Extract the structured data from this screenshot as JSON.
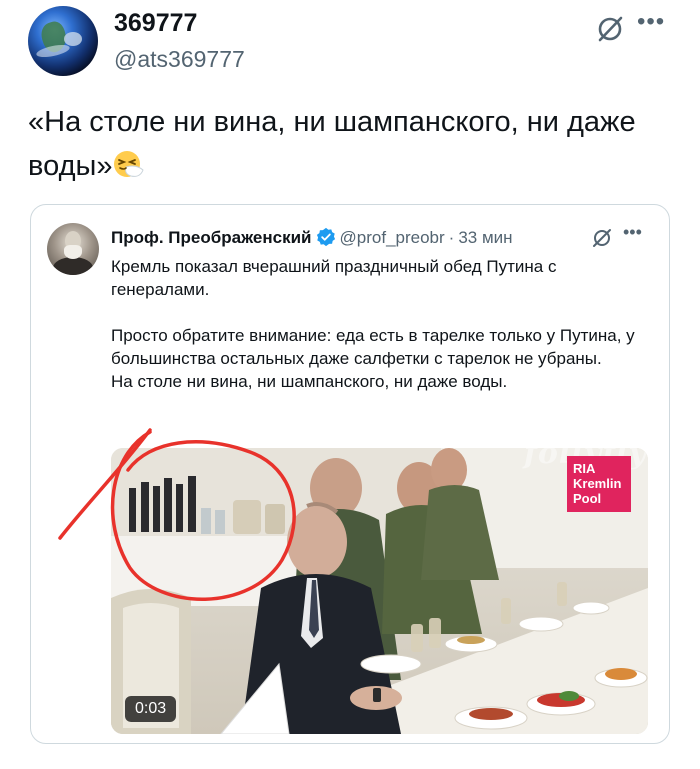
{
  "post": {
    "display_name": "369777",
    "handle": "@ats369777",
    "text": "«На столе ни вина, ни шампанского, ни даже воды»",
    "emoji_icon": "sneezing-face-icon"
  },
  "quoted": {
    "display_name": "Проф. Преображенский",
    "handle": "@prof_preobr",
    "separator": "·",
    "time": "33 мин",
    "paragraphs": [
      "Кремль показал вчерашний праздничный обед Путина с генералами.",
      "Просто обратите внимание: еда есть в тарелке только у Путина, у большинства остальных даже салфетки с тарелок не убраны.",
      "На столе ни вина, ни шампанского, ни даже воды."
    ],
    "video": {
      "watermark": "follyfly",
      "badge": [
        "RIA",
        "Kremlin",
        "Pool"
      ],
      "duration": "0:03"
    }
  },
  "colors": {
    "text": "#0f1419",
    "secondary": "#536471",
    "border": "#cfd9de",
    "verified": "#1d9bf0",
    "ria_badge": "#e0245e",
    "annotation": "#e8322b"
  },
  "icons": [
    "grok-icon",
    "more-icon",
    "verified-badge-icon"
  ]
}
